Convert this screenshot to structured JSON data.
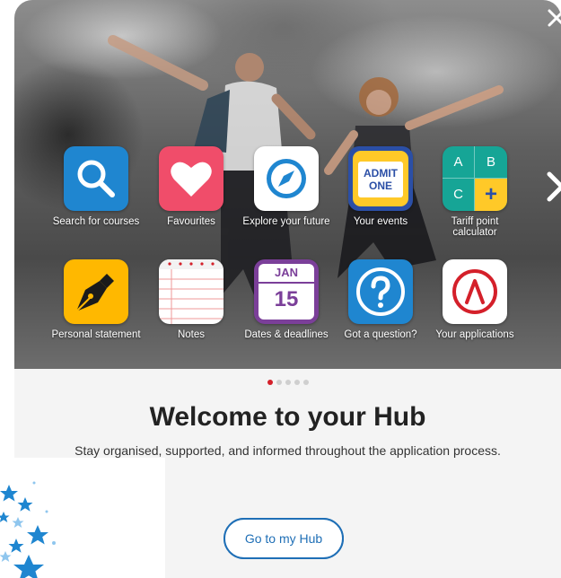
{
  "close_icon": "close-icon",
  "next_icon": "chevron-right-icon",
  "apps": [
    {
      "label": "Search for courses",
      "icon": "search-icon",
      "color": "#1f86d0"
    },
    {
      "label": "Favourites",
      "icon": "heart-icon",
      "color": "#f04d6a"
    },
    {
      "label": "Explore your future",
      "icon": "compass-icon",
      "color": "#ffffff"
    },
    {
      "label": "Your events",
      "icon": "ticket-icon",
      "color": "#ffc928",
      "ticket_line1": "ADMIT",
      "ticket_line2": "ONE"
    },
    {
      "label": "Tariff point calculator",
      "icon": "calculator-icon",
      "color": "#16a596",
      "keys": [
        "A",
        "B",
        "C",
        "+"
      ]
    },
    {
      "label": "Personal statement",
      "icon": "pen-icon",
      "color": "#ffb800"
    },
    {
      "label": "Notes",
      "icon": "notepad-icon",
      "color": "#ffffff"
    },
    {
      "label": "Dates & deadlines",
      "icon": "calendar-icon",
      "color": "#7b3f99",
      "cal_month": "JAN",
      "cal_day": "15"
    },
    {
      "label": "Got a question?",
      "icon": "question-icon",
      "color": "#1f86d0"
    },
    {
      "label": "Your applications",
      "icon": "applications-icon",
      "color": "#ffffff"
    }
  ],
  "pagination": {
    "count": 5,
    "active": 0
  },
  "welcome": {
    "title": "Welcome to your Hub",
    "subtitle": "Stay organised, supported, and informed throughout the application process."
  },
  "cta_label": "Go to my Hub",
  "colors": {
    "accent": "#1f6fb6",
    "dot_active": "#d4202a"
  }
}
